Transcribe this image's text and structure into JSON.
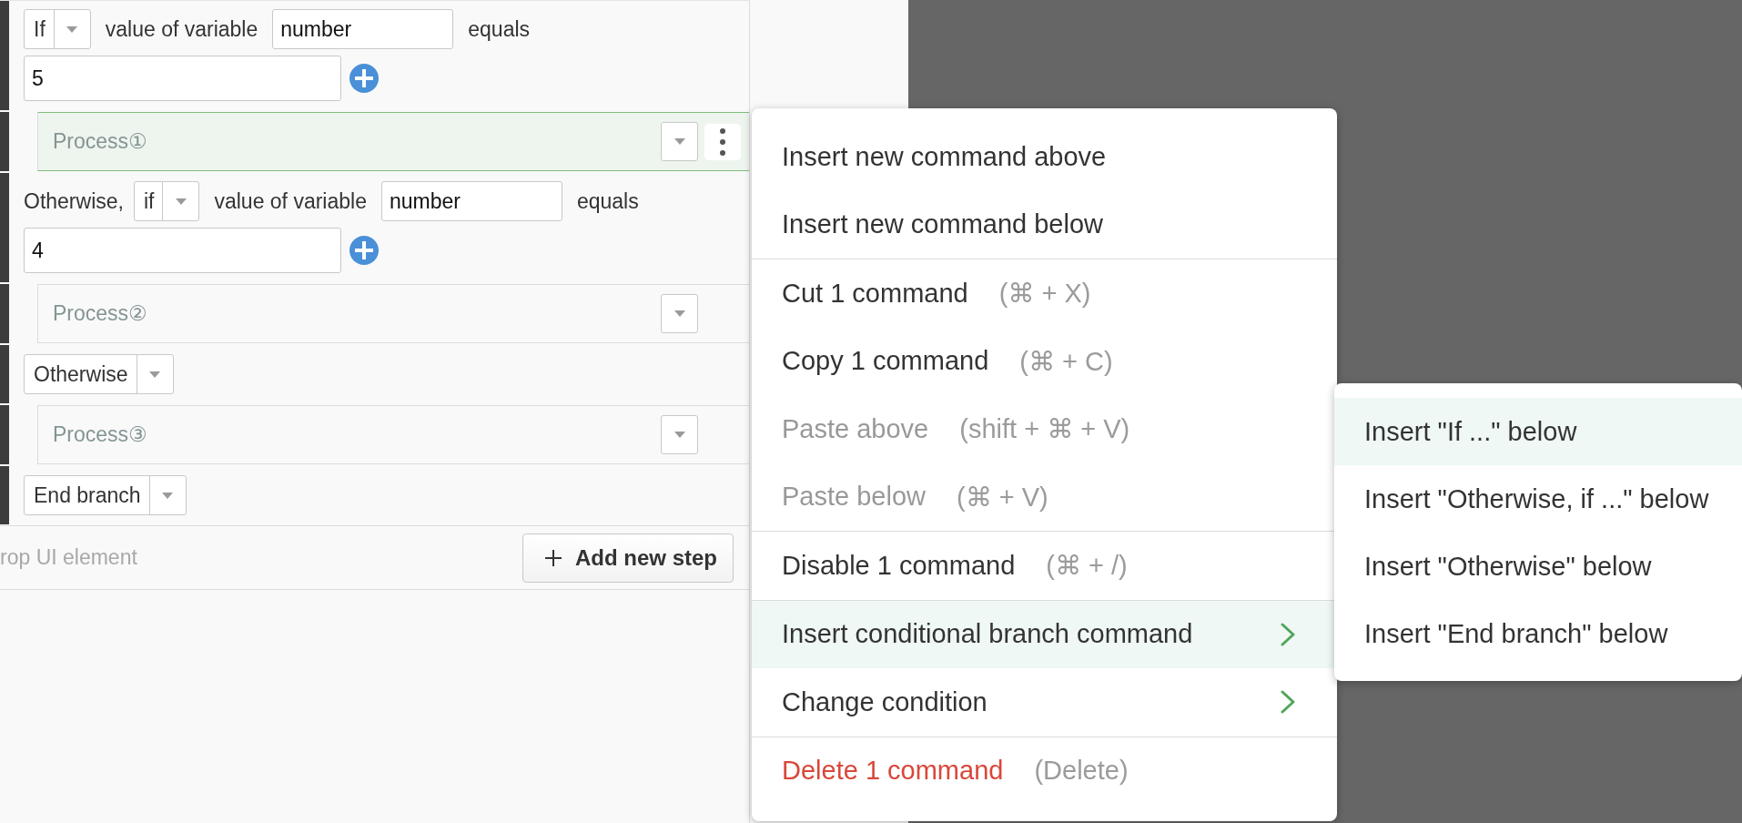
{
  "steps": [
    {
      "kind": "condition",
      "selected": false,
      "select": "If",
      "subject": "value of variable",
      "variable": "number",
      "operator": "equals",
      "value": "5"
    },
    {
      "kind": "process",
      "selected": true,
      "label": "Process①"
    },
    {
      "kind": "condition",
      "selected": false,
      "lead": "Otherwise,",
      "select": "if",
      "subject": "value of variable",
      "variable": "number",
      "operator": "equals",
      "value": "4"
    },
    {
      "kind": "process",
      "selected": false,
      "label": "Process②"
    },
    {
      "kind": "keyword",
      "selected": false,
      "select": "Otherwise"
    },
    {
      "kind": "process",
      "selected": false,
      "label": "Process③"
    },
    {
      "kind": "keyword",
      "selected": false,
      "select": "End branch"
    }
  ],
  "footer": {
    "drop_hint": "rop UI element",
    "add_button": "Add new step"
  },
  "context_menu": {
    "groups": [
      {
        "items": [
          {
            "kind": "normal",
            "label": "Insert new command above",
            "disabled": false,
            "selected": false,
            "submenu": false
          },
          {
            "kind": "normal",
            "label": "Insert new command below",
            "disabled": false,
            "selected": false,
            "submenu": false
          }
        ]
      },
      {
        "items": [
          {
            "kind": "normal",
            "label": "Cut 1 command",
            "shortcut": "(⌘ + X)",
            "disabled": false,
            "selected": false,
            "submenu": false
          },
          {
            "kind": "normal",
            "label": "Copy 1 command",
            "shortcut": "(⌘ + C)",
            "disabled": false,
            "selected": false,
            "submenu": false
          },
          {
            "kind": "normal",
            "label": "Paste above",
            "shortcut": "(shift + ⌘ + V)",
            "disabled": true,
            "selected": false,
            "submenu": false
          },
          {
            "kind": "normal",
            "label": "Paste below",
            "shortcut": "(⌘ + V)",
            "disabled": true,
            "selected": false,
            "submenu": false
          }
        ]
      },
      {
        "items": [
          {
            "kind": "normal",
            "label": "Disable 1 command",
            "shortcut": "(⌘ + /)",
            "disabled": false,
            "selected": false,
            "submenu": false
          }
        ]
      },
      {
        "items": [
          {
            "kind": "normal",
            "label": "Insert conditional branch command",
            "disabled": false,
            "selected": true,
            "submenu": true
          },
          {
            "kind": "normal",
            "label": "Change condition",
            "disabled": false,
            "selected": false,
            "submenu": true
          }
        ]
      },
      {
        "items": [
          {
            "kind": "danger",
            "label": "Delete 1 command",
            "shortcut": "(Delete)",
            "disabled": false,
            "selected": false,
            "submenu": false
          }
        ]
      }
    ]
  },
  "submenu": {
    "items": [
      {
        "label": "Insert \"If ...\" below",
        "selected": true
      },
      {
        "label": "Insert \"Otherwise, if ...\" below",
        "selected": false
      },
      {
        "label": "Insert \"Otherwise\" below",
        "selected": false
      },
      {
        "label": "Insert \"End branch\" below",
        "selected": false
      }
    ]
  }
}
